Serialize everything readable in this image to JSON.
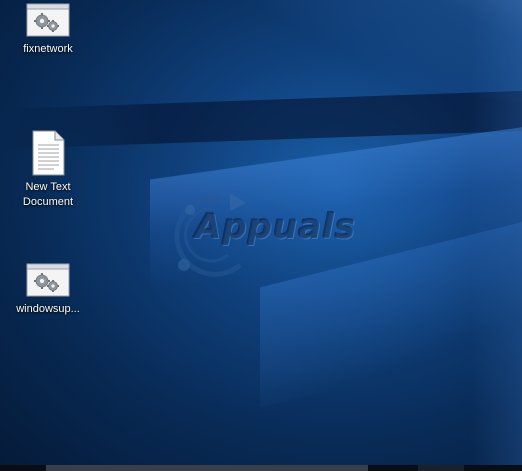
{
  "desktop": {
    "icons": [
      {
        "label": "fixnetwork",
        "icon": "batch-file-gears-icon"
      },
      {
        "label": "New Text Document",
        "icon": "text-document-icon"
      },
      {
        "label": "windowsup...",
        "icon": "batch-file-gears-icon"
      }
    ]
  },
  "watermark": {
    "text": "Appuals"
  },
  "colors": {
    "wallpaper_dark": "#051a38",
    "wallpaper_mid": "#0f3f7a",
    "wallpaper_light": "#1a5fa8",
    "taskbar": "#0a0d14",
    "label_text": "#ffffff"
  }
}
